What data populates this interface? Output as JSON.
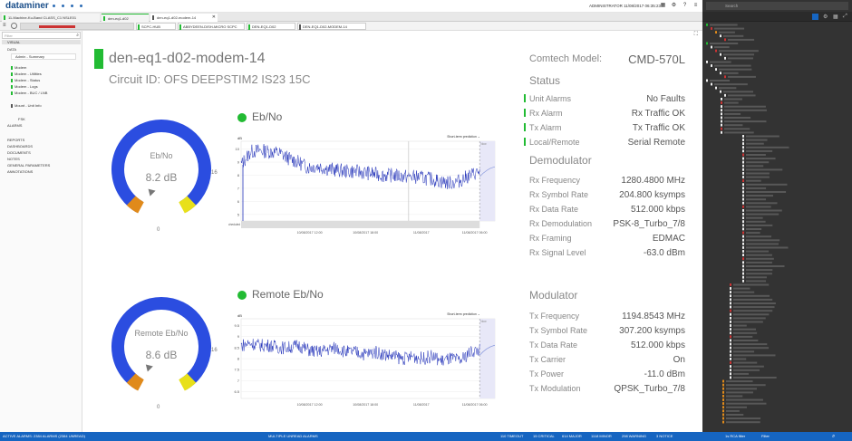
{
  "header": {
    "brand": "dataminer",
    "user": "ADMINISTRATOR 11/08/2017 06:35:23"
  },
  "tabs": [
    {
      "label": "11-Machine-Ku-Band CLASS_C1 NSLE01"
    },
    {
      "label": "den-eq1-d02"
    },
    {
      "label": "den-eq1-d02-modem-14"
    }
  ],
  "breadcrumbs": [
    {
      "label": ""
    },
    {
      "label": "SCPC-HUB"
    },
    {
      "label": "ABBYDEEN-DISH-MICRO SCPC"
    },
    {
      "label": "DEN-EQ1-D02"
    },
    {
      "label": "DEN-EQ1-D02-MODEM-14"
    }
  ],
  "sidebar": {
    "filter_placeholder": "Filter",
    "visual": "VISUAL",
    "data": "DATA",
    "admin_summary": "Admin - Summary",
    "modem": "Modem",
    "modem_utilities": "Modem - Utilities",
    "modem_status": "Modem - Status",
    "modem_logs": "Modem - Logs",
    "modem_buc": "Modem - BUC / LNB",
    "mount": "Mount - Unit Info",
    "fsk": "FSK",
    "alarms": "ALARMS",
    "reports": "REPORTS",
    "dashboards": "DASHBOARDS",
    "documents": "DOCUMENTS",
    "notes": "NOTES",
    "general_parameters": "GENERAL PARAMETERS",
    "annotations": "ANNOTATIONS"
  },
  "device": {
    "name": "den-eq1-d02-modem-14",
    "circuit": "Circuit ID: OFS DEEPSTIM2 IS23 15C",
    "model_label": "Comtech Model:",
    "model_value": "CMD-570L"
  },
  "status": {
    "title": "Status",
    "rows": [
      {
        "label": "Unit Alarms",
        "value": "No Faults"
      },
      {
        "label": "Rx Alarm",
        "value": "Rx Traffic OK"
      },
      {
        "label": "Tx Alarm",
        "value": "Tx Traffic OK"
      },
      {
        "label": "Local/Remote",
        "value": "Serial Remote"
      }
    ]
  },
  "demodulator": {
    "title": "Demodulator",
    "rows": [
      {
        "label": "Rx Frequency",
        "value": "1280.4800 MHz"
      },
      {
        "label": "Rx Symbol Rate",
        "value": "204.800 ksymps"
      },
      {
        "label": "Rx Data Rate",
        "value": "512.000 kbps"
      },
      {
        "label": "Rx Demodulation",
        "value": "PSK-8_Turbo_7/8"
      },
      {
        "label": "Rx Framing",
        "value": "EDMAC"
      },
      {
        "label": "Rx Signal Level",
        "value": "-63.0 dBm"
      }
    ]
  },
  "modulator": {
    "title": "Modulator",
    "rows": [
      {
        "label": "Tx Frequency",
        "value": "1194.8543 MHz"
      },
      {
        "label": "Tx Symbol Rate",
        "value": "307.200 ksymps"
      },
      {
        "label": "Tx Data Rate",
        "value": "512.000 kbps"
      },
      {
        "label": "Tx Carrier",
        "value": "On"
      },
      {
        "label": "Tx Power",
        "value": "-11.0 dBm"
      },
      {
        "label": "Tx Modulation",
        "value": "QPSK_Turbo_7/8"
      }
    ]
  },
  "ebno_gauge": {
    "label": "Eb/No",
    "value_text": "8.2 dB",
    "min": "0",
    "max": "16",
    "value": 8.2
  },
  "remote_gauge": {
    "label": "Remote Eb/No",
    "value_text": "8.6 dB",
    "min": "0",
    "max": "16",
    "value": 8.6
  },
  "chart_data": [
    {
      "type": "line",
      "title": "Eb/No",
      "ylabel": "dB",
      "prediction_label": "Short-term prediction",
      "now_label": "Now",
      "scheduled_label": "Scheduled",
      "x_ticks": [
        "10/08/2017 12:00",
        "10/08/2017 18:00",
        "11/08/2017",
        "11/08/2017 06:00"
      ],
      "y_ticks": [
        "10",
        "9",
        "8",
        "7",
        "6",
        "5"
      ],
      "ylim": [
        4.5,
        10.6
      ],
      "series": [
        {
          "values": [
            8.8,
            9.8,
            9.9,
            9.8,
            9.7,
            9.3,
            9.0,
            8.6,
            8.7,
            8.5,
            8.4,
            8.3,
            8.3,
            8.2,
            8.1,
            8.0,
            8.0,
            7.9,
            7.9,
            7.8,
            7.7,
            7.5,
            7.4,
            7.6,
            8.0,
            8.3
          ]
        }
      ]
    },
    {
      "type": "line",
      "title": "Remote Eb/No",
      "ylabel": "dB",
      "prediction_label": "Short-term prediction",
      "now_label": "Now",
      "x_ticks": [
        "10/08/2017 12:00",
        "10/08/2017 18:00",
        "11/08/2017",
        "11/08/2017 06:00"
      ],
      "y_ticks": [
        "9.5",
        "9",
        "8.5",
        "8",
        "7.5",
        "7",
        "6.5"
      ],
      "ylim": [
        6.2,
        9.8
      ],
      "series": [
        {
          "values": [
            8.6,
            8.7,
            8.6,
            8.6,
            8.5,
            8.5,
            8.6,
            8.4,
            8.3,
            8.4,
            8.5,
            8.3,
            8.3,
            8.2,
            8.3,
            8.2,
            8.1,
            8.0,
            8.1,
            8.0,
            8.1,
            7.9,
            8.0,
            7.9,
            8.3,
            8.4
          ]
        }
      ]
    }
  ],
  "statusbar": {
    "left": "ACTIVE ALARMS: 2384 ALARMS (2384 UNREAD)",
    "center": "MULTIPLE UNREAD ALARMS",
    "timeout": "110 TIMEOUT",
    "critical": "15 CRITICAL",
    "major": "614 MAJOR",
    "minor": "1118 MINOR",
    "warning": "298 WARNING",
    "notice": "3 NOTICE",
    "right": "1s RCA filter",
    "filter": "Filter"
  },
  "right_panel": {
    "search_placeholder": "Search"
  },
  "colors": {
    "accent": "#1665c1",
    "ok": "#22bb33",
    "gauge_blue": "#2b4de0",
    "chart_line": "#1f2fb8"
  }
}
